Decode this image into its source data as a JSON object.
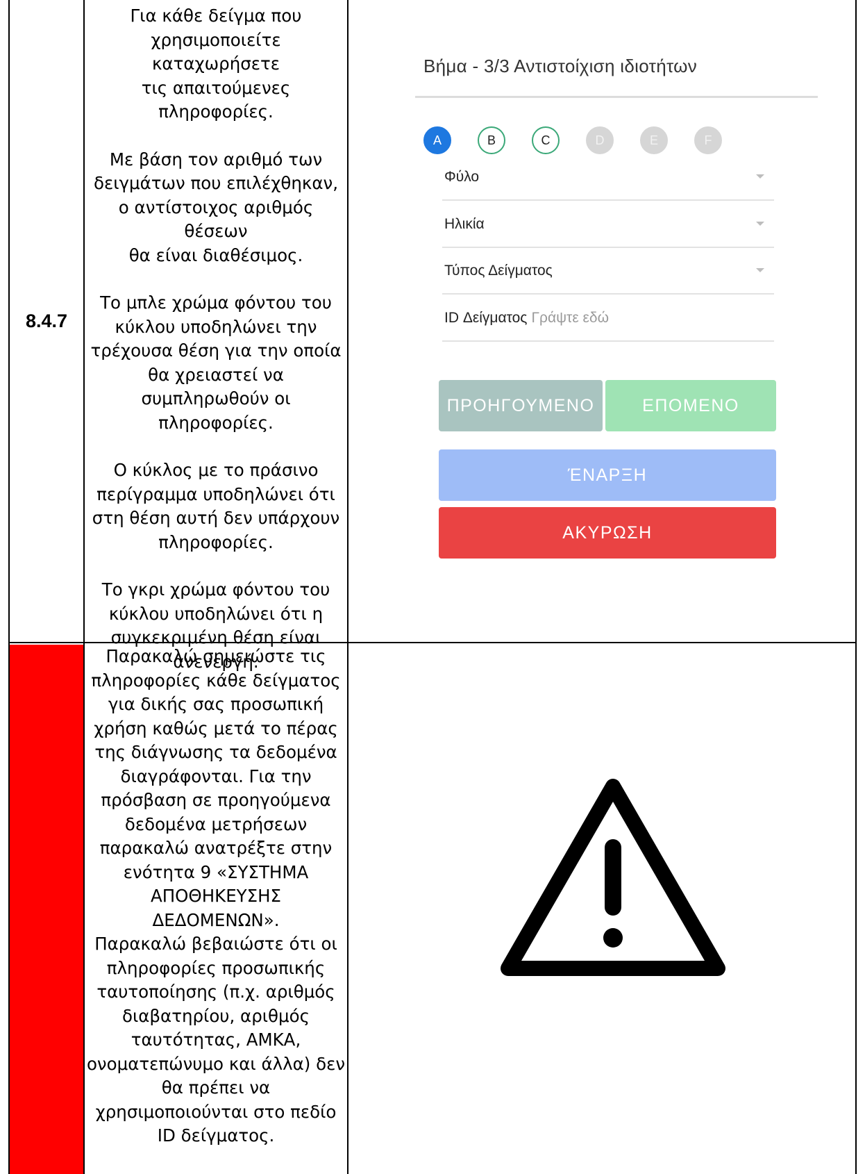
{
  "row1": {
    "section_number": "8.4.7",
    "paragraphs": [
      [
        "Για κάθε δείγμα που",
        "χρησιμοποιείτε καταχωρήσετε",
        "τις απαιτούμενες",
        "πληροφορίες."
      ],
      [
        "Με βάση τον αριθμό των",
        "δειγμάτων που επιλέχθηκαν,",
        "ο αντίστοιχος αριθμός θέσεων",
        "θα είναι διαθέσιμος."
      ],
      [
        "Το μπλε χρώμα φόντου του",
        "κύκλου υποδηλώνει την",
        "τρέχουσα θέση για την οποία",
        "θα χρειαστεί να",
        "συμπληρωθούν οι",
        "πληροφορίες."
      ],
      [
        "Ο κύκλος με το πράσινο",
        "περίγραμμα υποδηλώνει ότι",
        "στη θέση αυτή δεν υπάρχουν",
        "πληροφορίες."
      ],
      [
        "Το γκρι χρώμα φόντου του",
        "κύκλου υποδηλώνει ότι η",
        "συγκεκριμένη θέση είναι",
        "ανενεργή."
      ]
    ],
    "screen": {
      "step_title": "Βήμα - 3/3 Αντιστοίχιση ιδιοτήτων",
      "positions": [
        {
          "label": "A",
          "state": "active"
        },
        {
          "label": "B",
          "state": "empty"
        },
        {
          "label": "C",
          "state": "empty"
        },
        {
          "label": "D",
          "state": "disabled"
        },
        {
          "label": "E",
          "state": "disabled"
        },
        {
          "label": "F",
          "state": "disabled"
        }
      ],
      "fields": {
        "gender": "Φύλο",
        "age": "Ηλικία",
        "sample_type": "Τύπος Δείγματος",
        "sample_id_label": "ID Δείγματος",
        "sample_id_placeholder": "Γράψτε εδώ"
      },
      "buttons": {
        "previous": "ΠΡΟΗΓΟΥΜΕΝΟ",
        "next": "ΕΠΟΜΕΝΟ",
        "start": "ΈΝΑΡΞΗ",
        "cancel": "ΑΚΥΡΩΣΗ"
      },
      "colors": {
        "active": "#1e78e0",
        "empty_border": "#3aa878",
        "disabled": "#d6d6d6",
        "previous": "#a9c4c0",
        "next": "#9fe3b4",
        "start": "#9ebcf7",
        "cancel": "#ea4343"
      }
    }
  },
  "row2": {
    "flag_color": "#ff0000",
    "lines": [
      "Παρακαλώ σημειώστε τις",
      "πληροφορίες κάθε δείγματος",
      "για δικής σας προσωπική",
      "χρήση καθώς μετά το πέρας",
      "της διάγνωσης τα δεδομένα",
      "διαγράφονται. Για την",
      "πρόσβαση σε προηγούμενα",
      "δεδομένα μετρήσεων",
      "παρακαλώ ανατρέξτε στην",
      "ενότητα 9 «ΣΥΣΤΗΜΑ",
      "ΑΠΟΘΗΚΕΥΣΗΣ",
      "ΔΕΔΟΜΕΝΩΝ».",
      "Παρακαλώ βεβαιώστε ότι οι",
      "πληροφορίες προσωπικής",
      "ταυτοποίησης (π.χ. αριθμός",
      "διαβατηρίου, αριθμός",
      "ταυτότητας, ΑΜΚΑ,",
      "ονοματεπώνυμο και άλλα) δεν",
      "θα πρέπει να",
      "χρησιμοποιούνται στο πεδίο",
      "ID δείγματος."
    ],
    "icon": "warning-icon"
  }
}
